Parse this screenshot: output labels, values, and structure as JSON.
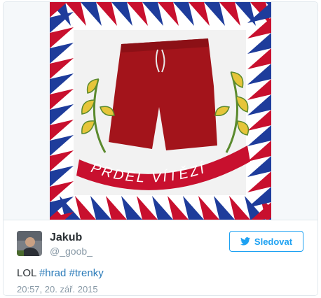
{
  "media": {
    "image": "embedded-photo",
    "banner_text": "PRDEL VÍTĚZÍ",
    "colors": {
      "red": "#c8102e",
      "blue": "#1e3c9b",
      "shorts": "#a3141b",
      "leaf": "#e6c53a"
    }
  },
  "author": {
    "name": "Jakub",
    "handle": "@_goob_",
    "avatar": "profile-photo"
  },
  "follow_button": {
    "label": "Sledovat",
    "icon": "twitter-bird-icon",
    "color": "#1da1f2"
  },
  "tweet": {
    "prefix": "LOL ",
    "hashtags": [
      "#hrad",
      "#trenky"
    ],
    "timestamp": "20:57, 20. zář. 2015"
  }
}
